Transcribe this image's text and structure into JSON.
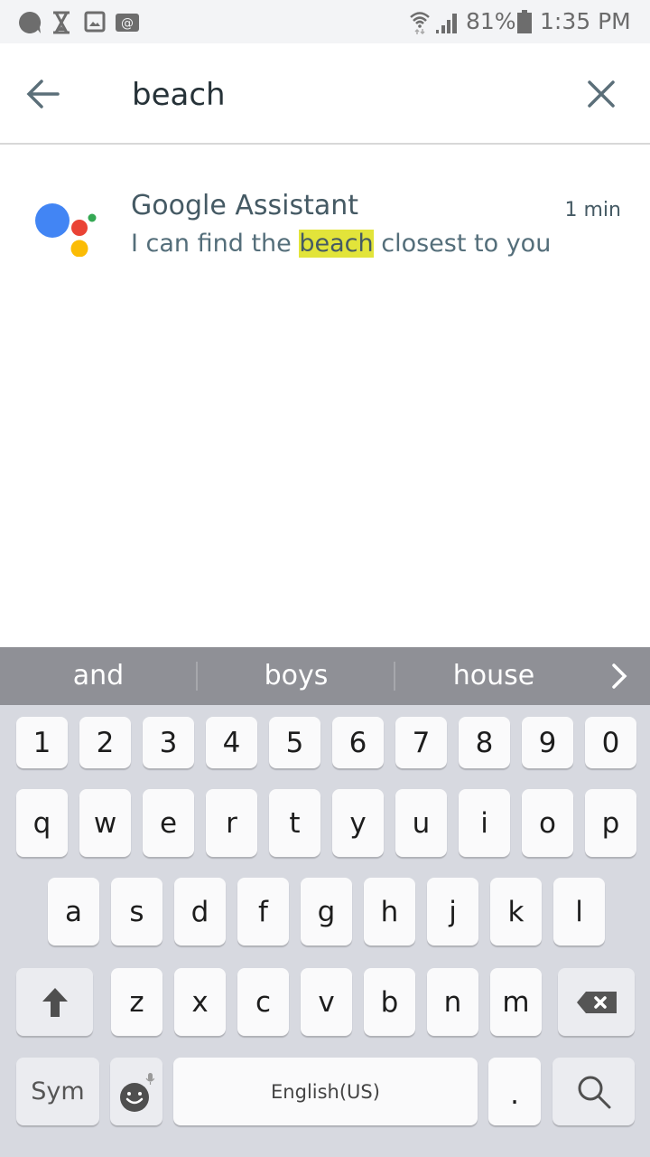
{
  "status_bar": {
    "left_icons": [
      "chat-bubble-icon",
      "hourglass-icon",
      "image-icon",
      "email-at-icon"
    ],
    "right_icons": [
      "wifi-icon",
      "signal-icon",
      "battery-icon"
    ],
    "battery": "81%",
    "time": "1:35 PM"
  },
  "search": {
    "query": "beach",
    "back_icon": "arrow-left-icon",
    "clear_icon": "close-icon"
  },
  "results": [
    {
      "app": "Google Assistant",
      "time": "1 min",
      "snippet_before": "I can find the ",
      "snippet_match": "beach",
      "snippet_after": " closest to you",
      "logo_colors": {
        "blue": "#4285f4",
        "red": "#ea4335",
        "yellow": "#fbbc05",
        "green": "#34a853"
      },
      "highlight_color": "#e2e43a"
    }
  ],
  "keyboard": {
    "suggestions": [
      "and",
      "boys",
      "house"
    ],
    "suggestions_more_icon": "chevron-right-icon",
    "number_row": [
      "1",
      "2",
      "3",
      "4",
      "5",
      "6",
      "7",
      "8",
      "9",
      "0"
    ],
    "row1": [
      "q",
      "w",
      "e",
      "r",
      "t",
      "y",
      "u",
      "i",
      "o",
      "p"
    ],
    "row2": [
      "a",
      "s",
      "d",
      "f",
      "g",
      "h",
      "j",
      "k",
      "l"
    ],
    "row3": [
      "z",
      "x",
      "c",
      "v",
      "b",
      "n",
      "m"
    ],
    "shift_icon": "shift-arrow-icon",
    "backspace_icon": "backspace-icon",
    "sym_label": "Sym",
    "emoji_icon": "emoji-smile-icon",
    "mic_icon": "microphone-icon",
    "space_label": "English(US)",
    "period_label": ".",
    "search_icon": "search-icon"
  }
}
